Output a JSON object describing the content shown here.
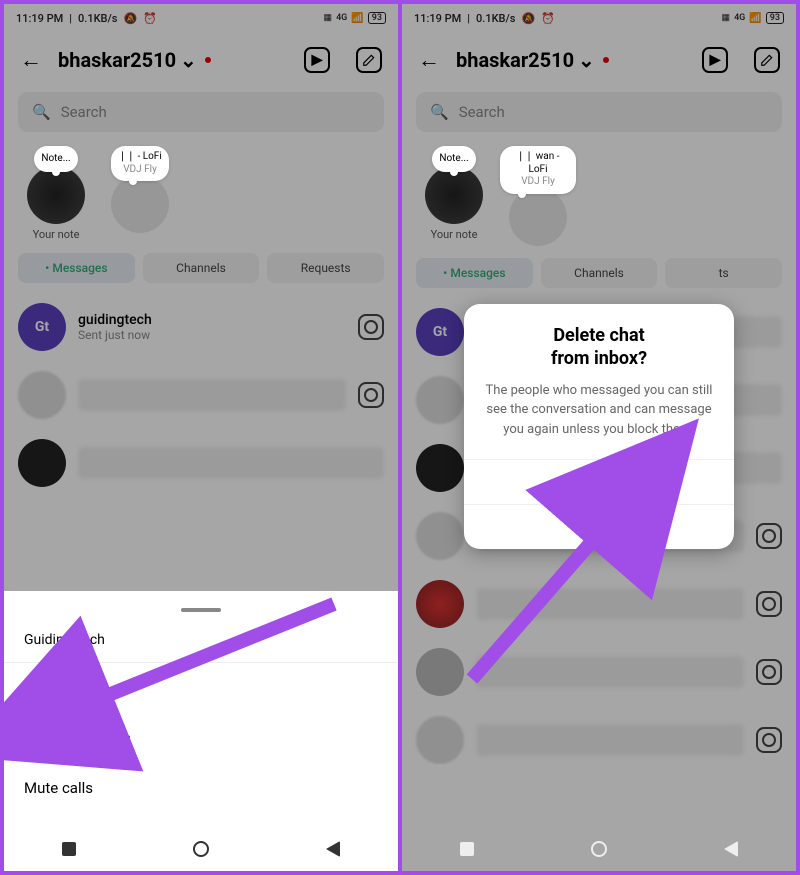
{
  "status": {
    "time": "11:19 PM",
    "net_speed": "0.1KB/s",
    "net_label_small": "4G",
    "battery": "93"
  },
  "header": {
    "username": "bhaskar2510",
    "chevron": "⌄"
  },
  "search": {
    "placeholder": "Search"
  },
  "notes": {
    "items": [
      {
        "bubble": "Note...",
        "label": "Your note"
      },
      {
        "bubble_top": "❘❘ - LoFi",
        "bubble_sub": "VDJ Fly",
        "label": ""
      },
      {
        "bubble_top": "❘❘ wan - LoFi",
        "bubble_sub": "VDJ Fly",
        "label": ""
      }
    ]
  },
  "tabs": {
    "messages": "Messages",
    "channels": "Channels",
    "requests": "Requests",
    "messages_dot": "•"
  },
  "chats": {
    "first_name": "guidingtech",
    "first_sub": "Sent just now",
    "avatar_gt": "Gt"
  },
  "sheet": {
    "title": "Guiding Tech",
    "delete": "Delete",
    "mute_msg": "Mute messages",
    "mute_calls": "Mute calls"
  },
  "dialog": {
    "title_l1": "Delete chat",
    "title_l2": "from inbox?",
    "body": "The people who messaged you can still see the conversation and can message you again unless you block them.",
    "delete": "Delete",
    "cancel": "Cancel"
  }
}
